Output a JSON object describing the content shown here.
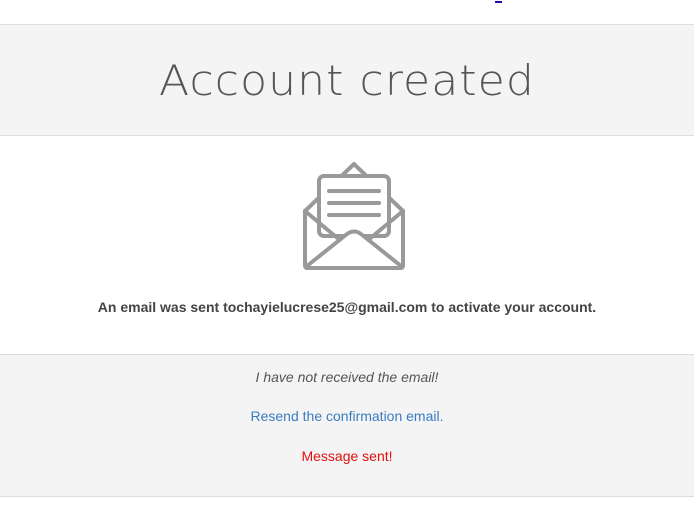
{
  "header": {
    "title": "Account created"
  },
  "main": {
    "icon": "envelope-open-icon",
    "sent_message": "An email was sent tochayielucrese25@gmail.com to activate your account."
  },
  "footer": {
    "not_received": "I have not received the email!",
    "resend_link": "Resend the confirmation email.",
    "status_message": "Message sent!"
  },
  "colors": {
    "header_bg": "#f4f4f4",
    "title_text": "#555555",
    "icon": "#999999",
    "link": "#3a7cc2",
    "status": "#e01010"
  }
}
